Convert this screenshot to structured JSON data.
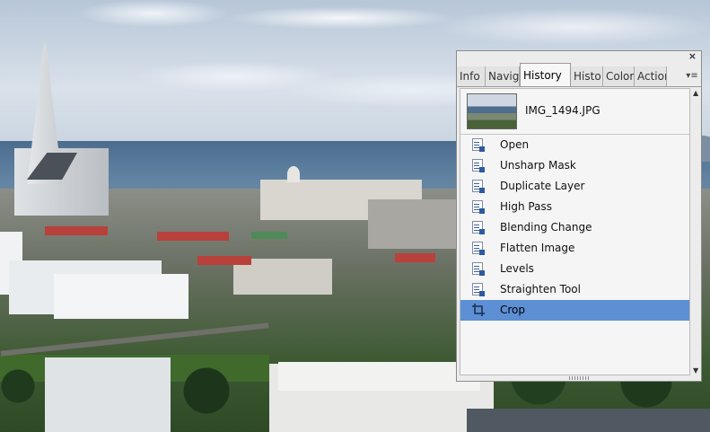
{
  "panel": {
    "close_glyph": "×",
    "menu_glyph": "▾≡",
    "tabs": [
      {
        "label": "Info",
        "active": false
      },
      {
        "label": "Navig",
        "active": false
      },
      {
        "label": "History",
        "active": true
      },
      {
        "label": "Histo",
        "active": false
      },
      {
        "label": "Color",
        "active": false
      },
      {
        "label": "Action",
        "active": false
      }
    ],
    "snapshot": {
      "name": "IMG_1494.JPG"
    },
    "history_steps": [
      {
        "label": "Open",
        "icon": "history-state-icon"
      },
      {
        "label": "Unsharp Mask",
        "icon": "history-state-icon"
      },
      {
        "label": "Duplicate Layer",
        "icon": "history-state-icon"
      },
      {
        "label": "High Pass",
        "icon": "history-state-icon"
      },
      {
        "label": "Blending Change",
        "icon": "history-state-icon"
      },
      {
        "label": "Flatten Image",
        "icon": "history-state-icon"
      },
      {
        "label": "Levels",
        "icon": "history-state-icon"
      },
      {
        "label": "Straighten Tool",
        "icon": "history-state-icon"
      },
      {
        "label": "Crop",
        "icon": "crop-icon",
        "selected": true
      }
    ],
    "selection_color": "#5c8fd4"
  }
}
